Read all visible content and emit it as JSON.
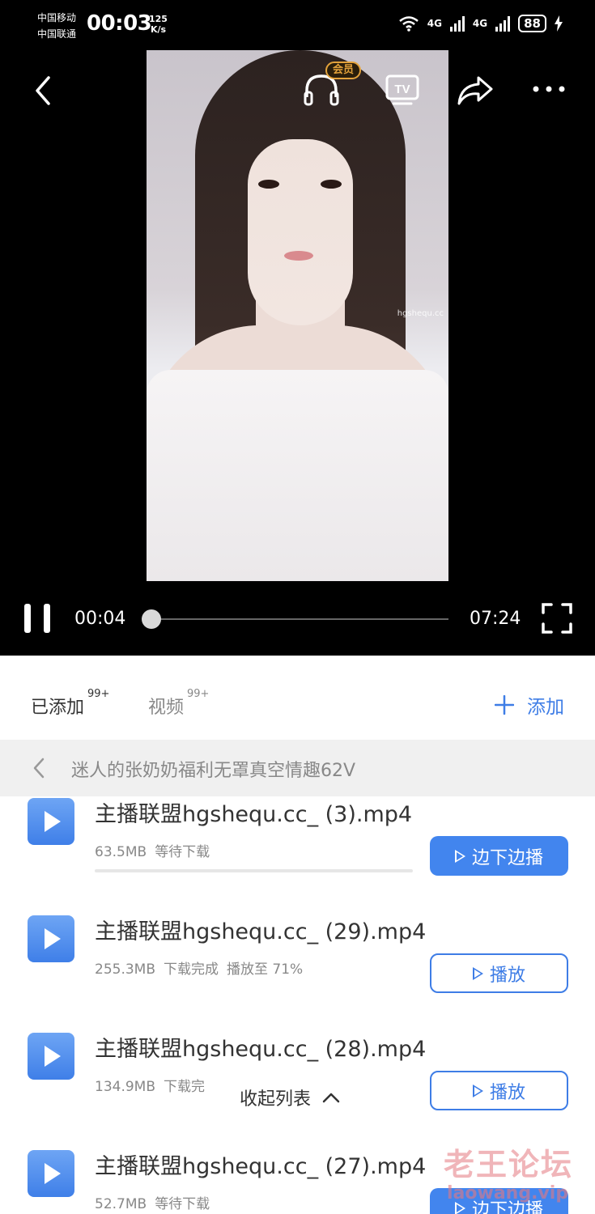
{
  "status_bar": {
    "carrier_1": "中国移动",
    "carrier_2": "中国联通",
    "time": "00:03",
    "speed_value": "125",
    "speed_unit": "K/s",
    "net_1": "4G",
    "net_2": "4G",
    "battery": "88"
  },
  "player": {
    "vip_badge": "会员",
    "tv_label": "TV",
    "video_watermark": "hgshequ.cc",
    "current_time": "00:04",
    "total_time": "07:24",
    "progress_fraction": 0.009
  },
  "tabs": {
    "added_label": "已添加",
    "added_count": "99+",
    "video_label": "视频",
    "video_count": "99+",
    "add_label": "添加"
  },
  "folder": {
    "title": "迷人的张奶奶福利无罩真空情趣62V"
  },
  "files": [
    {
      "name": "主播联盟hgshequ.cc_ (3).mp4",
      "size": "63.5MB",
      "status": "等待下载",
      "extra": "",
      "button": "边下边播",
      "style": "primary"
    },
    {
      "name": "主播联盟hgshequ.cc_ (29).mp4",
      "size": "255.3MB",
      "status": "下载完成",
      "extra": "播放至 71%",
      "button": "播放",
      "style": "outline"
    },
    {
      "name": "主播联盟hgshequ.cc_ (28).mp4",
      "size": "134.9MB",
      "status": "下载完",
      "extra": "",
      "button": "播放",
      "style": "outline"
    },
    {
      "name": "主播联盟hgshequ.cc_ (27).mp4",
      "size": "52.7MB",
      "status": "等待下载",
      "extra": "",
      "button": "边下边播",
      "style": "primary"
    }
  ],
  "collapse_label": "收起列表",
  "forum_watermark": {
    "name": "老王论坛",
    "url": "laowang.vip"
  },
  "colors": {
    "accent": "#3e7de6",
    "player_bg": "#000000",
    "vip": "#e3a23b"
  },
  "icons": [
    "back-icon",
    "headphones-icon",
    "tv-icon",
    "share-icon",
    "more-icon",
    "pause-icon",
    "fullscreen-icon",
    "plus-icon",
    "chevron-left-icon",
    "play-file-icon",
    "play-triangle-icon",
    "chevron-up-icon"
  ]
}
